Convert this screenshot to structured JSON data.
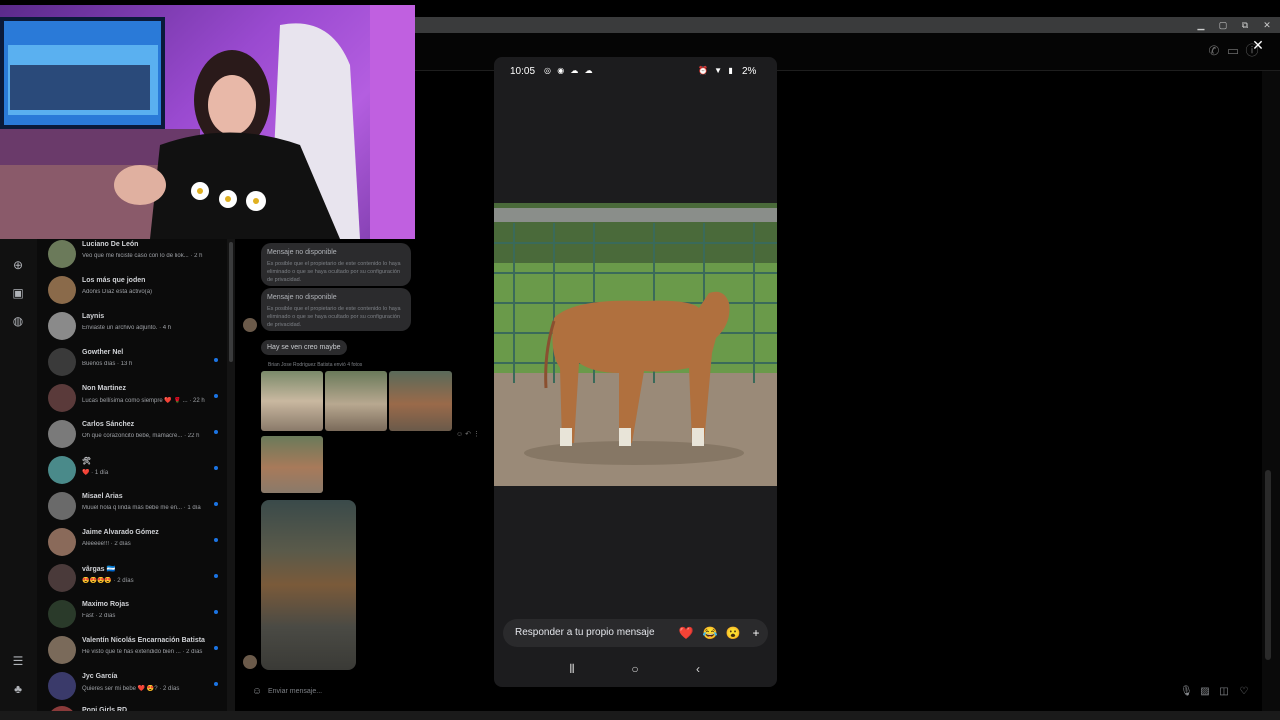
{
  "window": {
    "minimize_icon": "minimize-icon",
    "restore_icon": "restore-icon",
    "close_icon": "close-icon"
  },
  "chat_list": [
    {
      "name": "Luciano De León",
      "preview": "Veo que me hiciste caso con lo de liok...",
      "time": "· 2 h",
      "avatar_color": "#6b7a5a"
    },
    {
      "name": "Los más que joden",
      "preview": "Adonis Díaz está activo(a)",
      "time": "",
      "avatar_color": "#8a6a4a"
    },
    {
      "name": "Laynis",
      "preview": "Enviaste un archivo adjunto.",
      "time": "· 4 h",
      "avatar_color": "#8a8a8a"
    },
    {
      "name": "Gowther Nel",
      "preview": "Buenos días",
      "time": "· 13 h",
      "avatar_color": "#3a3a3a"
    },
    {
      "name": "Non Martinez",
      "preview": "Lucas bellísima como siempre ❤️ 🌹 ...",
      "time": "· 22 h",
      "avatar_color": "#5a3a3a"
    },
    {
      "name": "Carlos Sánchez",
      "preview": "Oh que corazoncito bebé, mamacre...",
      "time": "· 22 h",
      "avatar_color": "#7a7a7a"
    },
    {
      "name": "🛠",
      "preview": "❤️",
      "time": "· 1 día",
      "avatar_color": "#4a8a8a"
    },
    {
      "name": "Misael Arias",
      "preview": "Muuel hola q linda más bebe me en...",
      "time": "· 1 día",
      "avatar_color": "#6a6a6a"
    },
    {
      "name": "Jaime Alvarado Gómez",
      "preview": "Aleeeee!!!",
      "time": "· 2 días",
      "avatar_color": "#8a6a5a"
    },
    {
      "name": "vârgas 🇭🇳",
      "preview": "😍😍😍😍",
      "time": "· 2 días",
      "avatar_color": "#4a3a3a"
    },
    {
      "name": "Maximo Rojas",
      "preview": "Fast",
      "time": "· 2 días",
      "avatar_color": "#2a3a2a"
    },
    {
      "name": "Valentín Nicolás Encarnación Batista",
      "preview": "He visto que te has extendido bien ...",
      "time": "· 2 días",
      "avatar_color": "#7a6a5a"
    },
    {
      "name": "Jyc García",
      "preview": "Quieres ser mi bebe ❤️ 😍?",
      "time": "· 2 días",
      "avatar_color": "#3a3a6a"
    },
    {
      "name": "Popi Girls RD",
      "preview": "",
      "time": "",
      "avatar_color": "#8a3a3a"
    }
  ],
  "conversation": {
    "unavailable_title": "Mensaje no disponible",
    "unavailable_body": "Es posible que el propietario de este contenido lo haya eliminado o que se haya ocultado por su configuración de privacidad.",
    "short_message": "Hay se ven creo maybe",
    "sent_label": "Brian Jose Rodriguez Batista envió 4 fotos",
    "actions": "☺ ↶ ⋮"
  },
  "composer": {
    "placeholder": "Enviar mensaje..."
  },
  "phone": {
    "time": "10:05",
    "battery": "2%",
    "reply_placeholder": "Responder a tu propio mensaje",
    "reactions": [
      "❤️",
      "😂",
      "😮",
      "+"
    ]
  }
}
